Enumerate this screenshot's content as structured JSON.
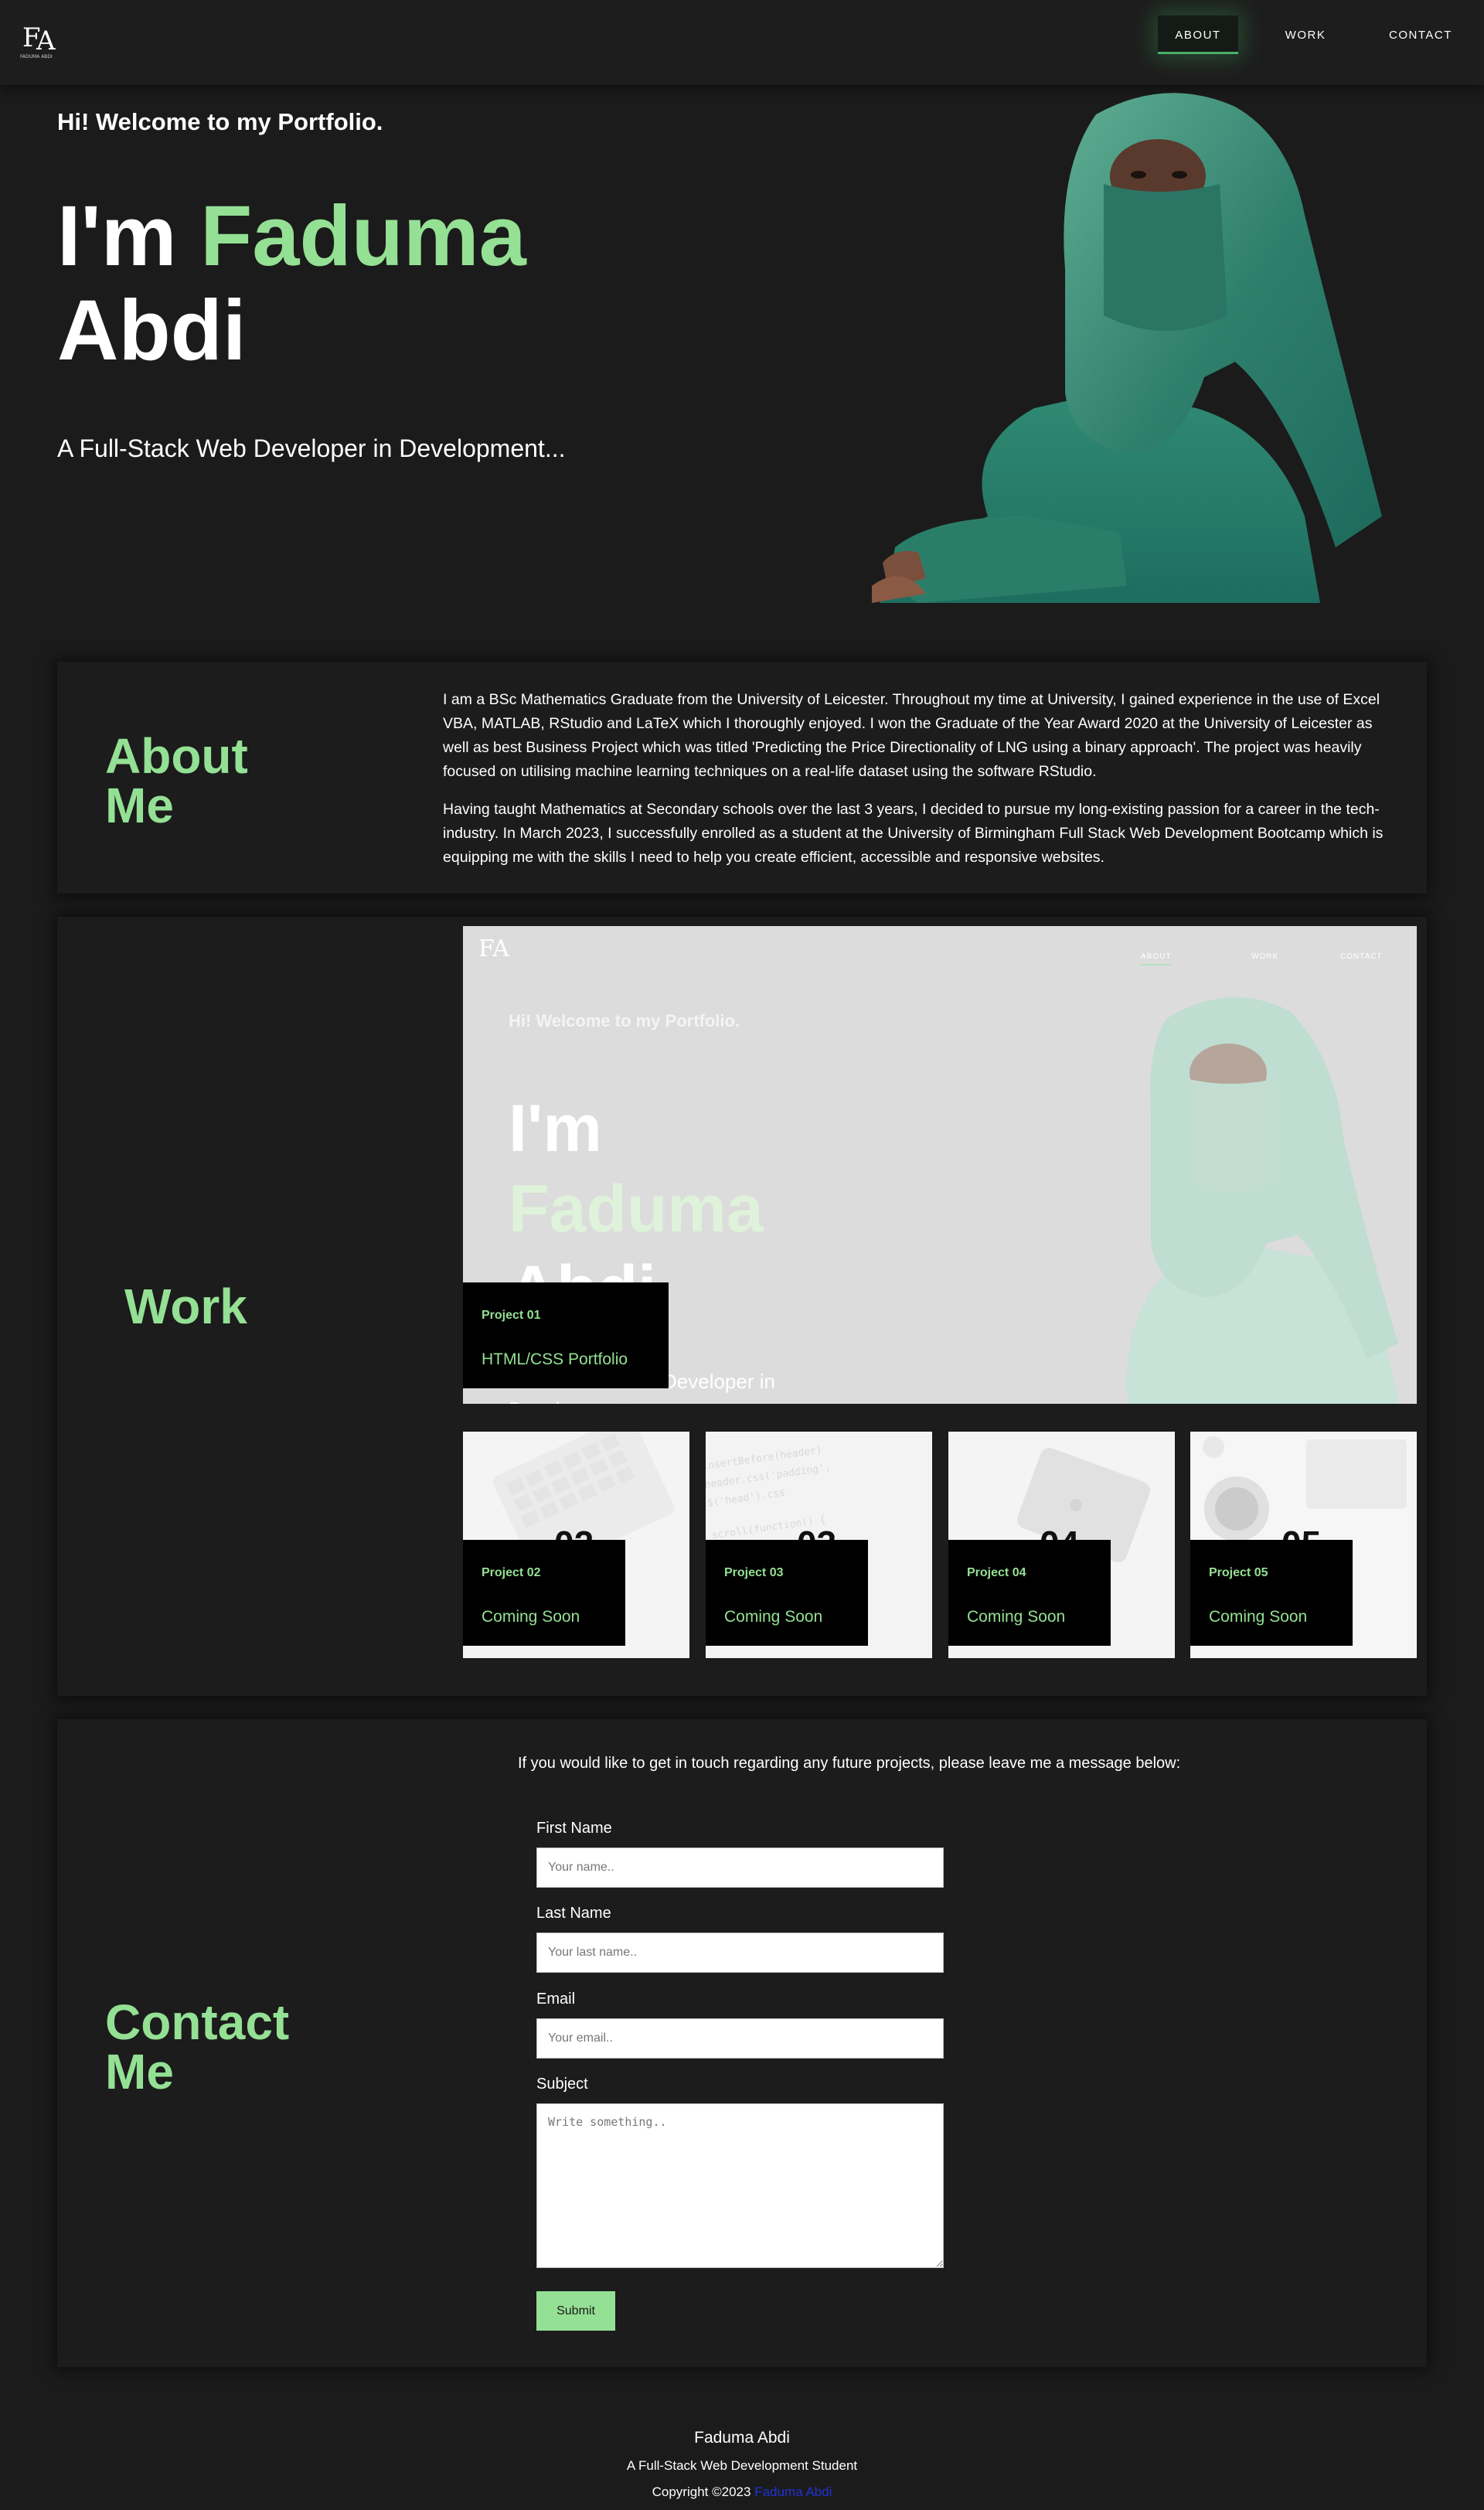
{
  "nav": {
    "logo_text": "FA",
    "logo_caption": "FADUMA ABDI",
    "links": [
      {
        "label": "ABOUT"
      },
      {
        "label": "WORK"
      },
      {
        "label": "CONTACT"
      }
    ]
  },
  "hero": {
    "greeting": "Hi! Welcome to my Portfolio.",
    "im": "I'm",
    "first_name": "Faduma",
    "last_name": "Abdi",
    "subtitle": "A Full-Stack Web Developer in Development..."
  },
  "about": {
    "title_line1": "About",
    "title_line2": "Me",
    "paragraphs": [
      "I am a BSc Mathematics Graduate from the University of Leicester. Throughout my time at University, I gained experience in the use of Excel VBA, MATLAB, RStudio and LaTeX which I thoroughly enjoyed. I won the Graduate of the Year Award 2020 at the University of Leicester as well as best Business Project which was titled 'Predicting the Price Directionality of LNG using a binary approach'. The project was heavily focused on utilising machine learning techniques on a real-life dataset using the software RStudio.",
      "Having taught Mathematics at Secondary schools over the last 3 years, I decided to pursue my long-existing passion for a career in the tech-industry. In March 2023, I successfully enrolled as a student at the University of Birmingham Full Stack Web Development Bootcamp which is equipping me with the skills I need to help you create efficient, accessible and responsive websites."
    ]
  },
  "work": {
    "title": "Work",
    "preview": {
      "greeting": "Hi! Welcome to my Portfolio.",
      "line1": "I'm",
      "line2": "Faduma",
      "line3": "Abdi",
      "subtitle_fragment": "Developer in",
      "subtitle_fragment2": "Development...",
      "nav": [
        "ABOUT",
        "WORK",
        "CONTACT"
      ]
    },
    "projects": [
      {
        "number": "Project 01",
        "title": "HTML/CSS Portfolio"
      },
      {
        "number": "Project 02",
        "title": "Coming Soon",
        "big_number": "02"
      },
      {
        "number": "Project 03",
        "title": "Coming Soon",
        "big_number": "03"
      },
      {
        "number": "Project 04",
        "title": "Coming Soon",
        "big_number": "04"
      },
      {
        "number": "Project 05",
        "title": "Coming Soon",
        "big_number": "05"
      }
    ]
  },
  "contact": {
    "title_line1": "Contact",
    "title_line2": "Me",
    "intro": "If you would like to get in touch regarding any future projects, please leave me a message below:",
    "fields": {
      "first_name": {
        "label": "First Name",
        "placeholder": "Your name.."
      },
      "last_name": {
        "label": "Last Name",
        "placeholder": "Your last name.."
      },
      "email": {
        "label": "Email",
        "placeholder": "Your email.."
      },
      "subject": {
        "label": "Subject",
        "placeholder": "Write something.."
      }
    },
    "submit_label": "Submit"
  },
  "footer": {
    "name": "Faduma Abdi",
    "subtitle": "A Full-Stack Web Development Student",
    "copyright": "Copyright ©2023",
    "link_text": "Faduma Abdi"
  },
  "colors": {
    "background": "#1b1b1b",
    "accent_green": "#94e094",
    "footer_link": "#1f33d6"
  }
}
